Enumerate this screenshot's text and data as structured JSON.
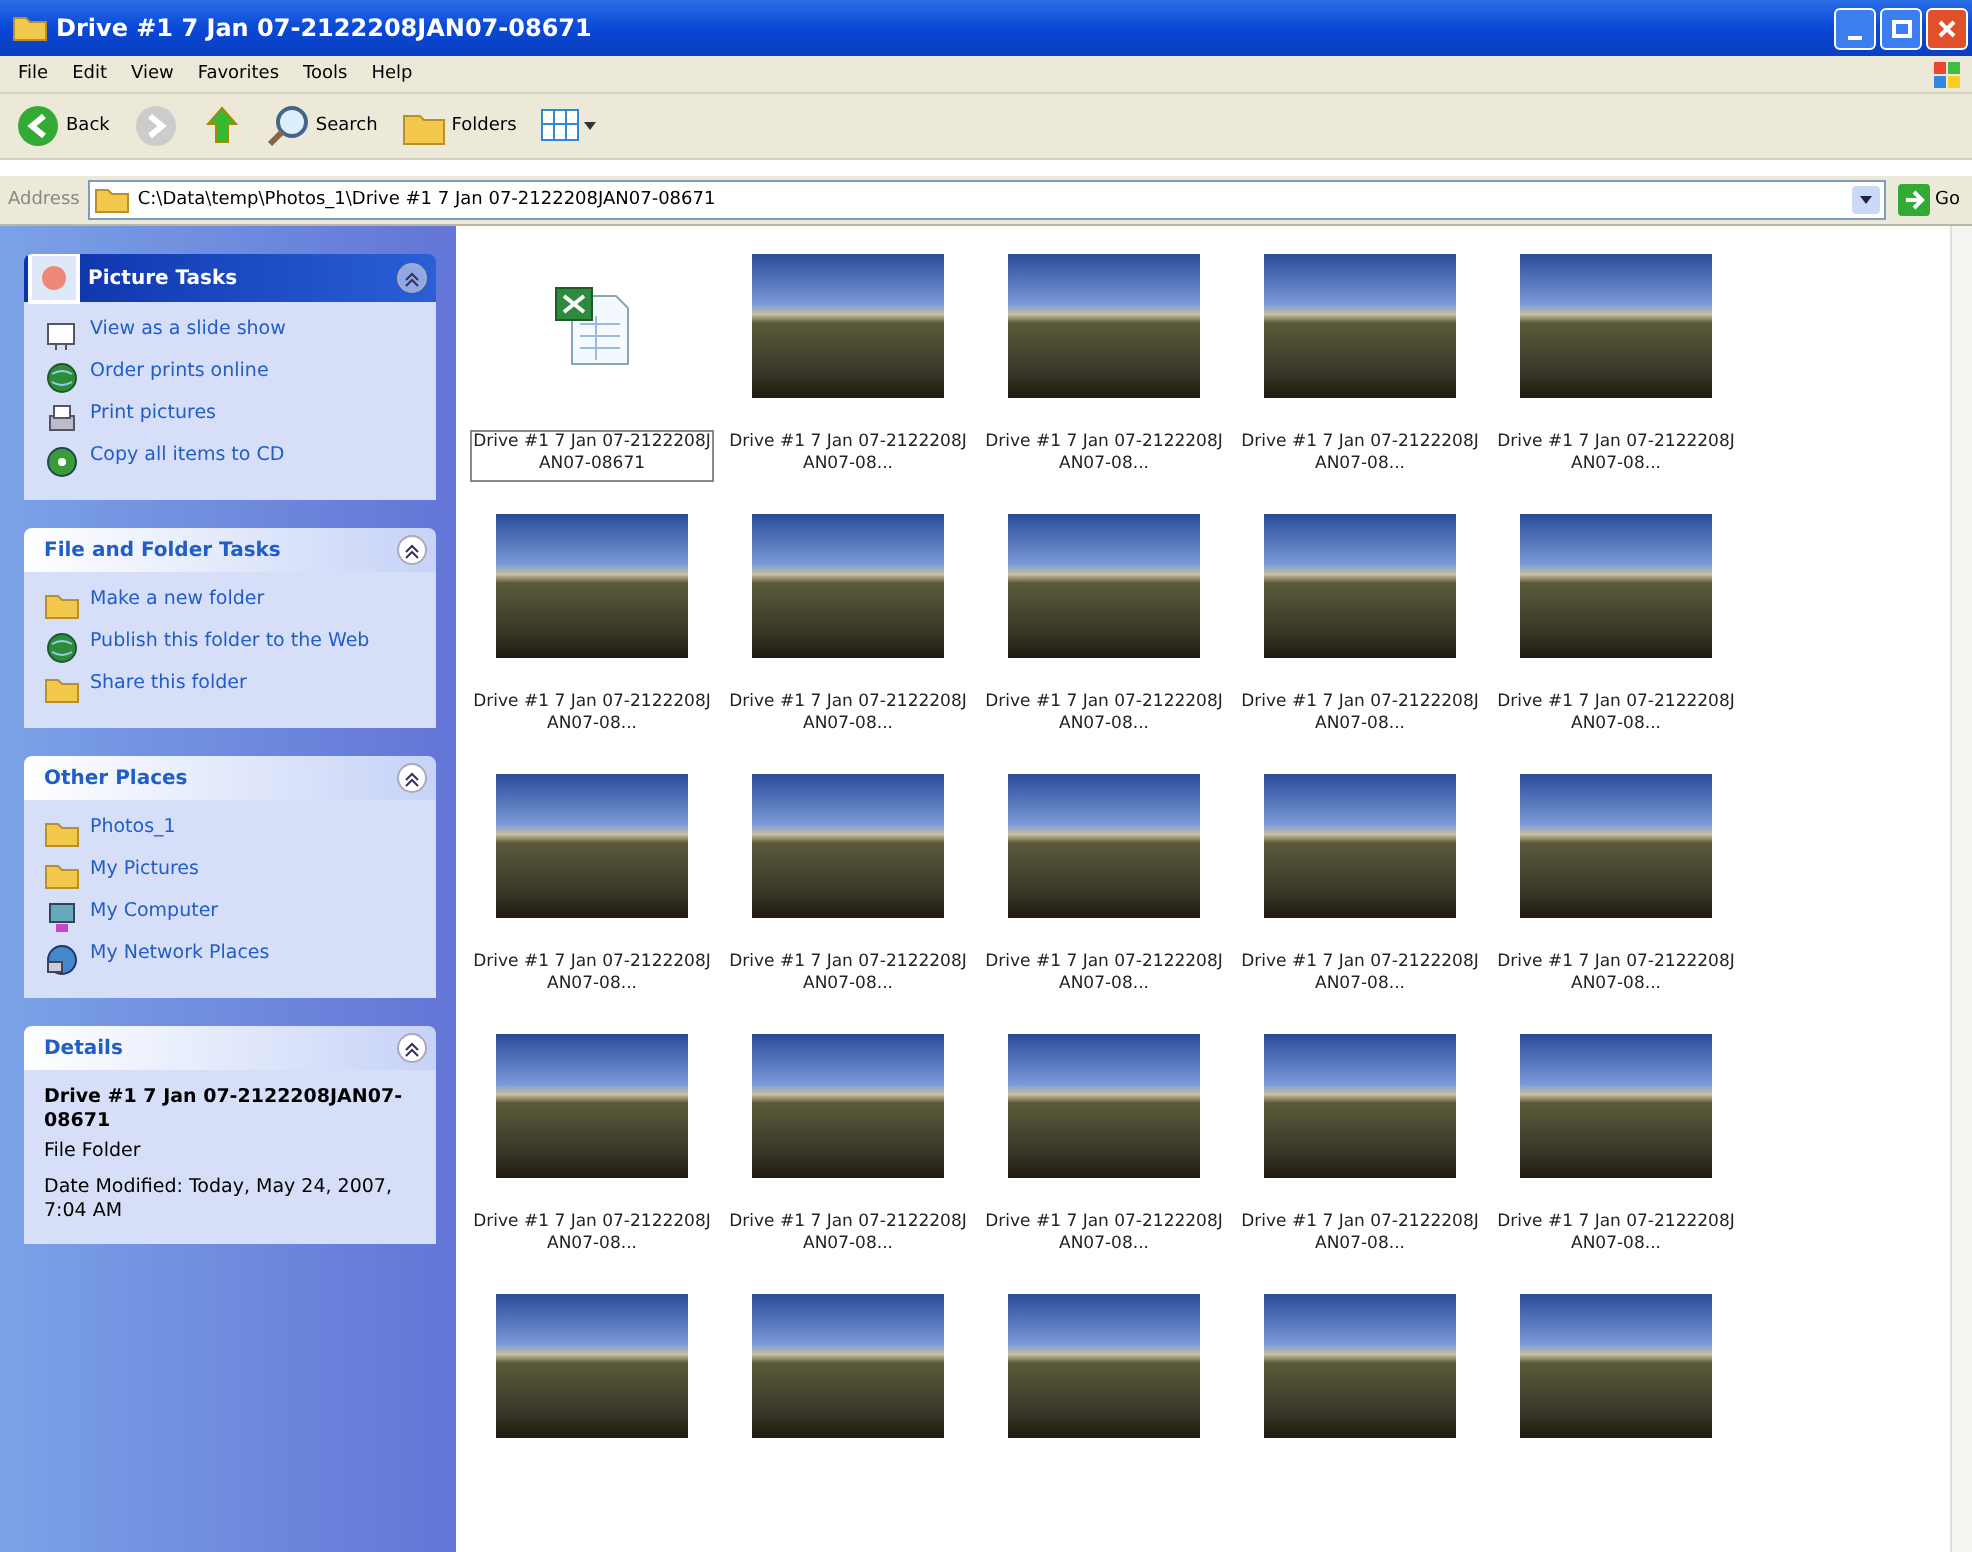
{
  "window": {
    "title": "Drive #1 7 Jan 07-2122208JAN07-08671"
  },
  "menu": [
    "File",
    "Edit",
    "View",
    "Favorites",
    "Tools",
    "Help"
  ],
  "toolbar": [
    {
      "kind": "back",
      "label": "Back"
    },
    {
      "kind": "forward"
    },
    {
      "kind": "up"
    },
    {
      "kind": "search",
      "label": "Search"
    },
    {
      "kind": "folders",
      "label": "Folders"
    },
    {
      "kind": "views"
    }
  ],
  "address": {
    "label": "Address",
    "value": "C:\\Data\\temp\\Photos_1\\Drive #1 7 Jan 07-2122208JAN07-08671",
    "go": "Go"
  },
  "sidebar": [
    {
      "title": "Picture Tasks",
      "kind": "special",
      "items": [
        {
          "kind": "slideshow",
          "label": "View as a slide show"
        },
        {
          "kind": "globe",
          "label": "Order prints online"
        },
        {
          "kind": "printer",
          "label": "Print pictures"
        },
        {
          "kind": "disc",
          "label": "Copy all items to CD"
        }
      ]
    },
    {
      "title": "File and Folder Tasks",
      "kind": "normal",
      "items": [
        {
          "kind": "folder",
          "label": "Make a new folder"
        },
        {
          "kind": "globe",
          "label": "Publish this folder to the Web"
        },
        {
          "kind": "folder",
          "label": "Share this folder"
        }
      ]
    },
    {
      "title": "Other Places",
      "kind": "normal",
      "items": [
        {
          "kind": "folder",
          "label": "Photos_1"
        },
        {
          "kind": "folder",
          "label": "My Pictures"
        },
        {
          "kind": "computer",
          "label": "My Computer"
        },
        {
          "kind": "network",
          "label": "My Network Places"
        }
      ]
    },
    {
      "title": "Details",
      "kind": "details",
      "name": "Drive #1 7 Jan 07-2122208JAN07-08671",
      "type": "File Folder",
      "modified": "Date Modified: Today, May 24, 2007, 7:04 AM"
    }
  ],
  "files": [
    {
      "kind": "spreadsheet",
      "label": "Drive #1 7 Jan 07-2122208JAN07-08671",
      "selected": true
    },
    {
      "kind": "photo",
      "label": "Drive #1 7 Jan 07-2122208JAN07-08...",
      "selected": false
    },
    {
      "kind": "photo",
      "label": "Drive #1 7 Jan 07-2122208JAN07-08...",
      "selected": false
    },
    {
      "kind": "photo",
      "label": "Drive #1 7 Jan 07-2122208JAN07-08...",
      "selected": false
    },
    {
      "kind": "photo",
      "label": "Drive #1 7 Jan 07-2122208JAN07-08...",
      "selected": false
    },
    {
      "kind": "photo",
      "label": "Drive #1 7 Jan 07-2122208JAN07-08...",
      "selected": false
    },
    {
      "kind": "photo",
      "label": "Drive #1 7 Jan 07-2122208JAN07-08...",
      "selected": false
    },
    {
      "kind": "photo",
      "label": "Drive #1 7 Jan 07-2122208JAN07-08...",
      "selected": false
    },
    {
      "kind": "photo",
      "label": "Drive #1 7 Jan 07-2122208JAN07-08...",
      "selected": false
    },
    {
      "kind": "photo",
      "label": "Drive #1 7 Jan 07-2122208JAN07-08...",
      "selected": false
    },
    {
      "kind": "photo",
      "label": "Drive #1 7 Jan 07-2122208JAN07-08...",
      "selected": false
    },
    {
      "kind": "photo",
      "label": "Drive #1 7 Jan 07-2122208JAN07-08...",
      "selected": false
    },
    {
      "kind": "photo",
      "label": "Drive #1 7 Jan 07-2122208JAN07-08...",
      "selected": false
    },
    {
      "kind": "photo",
      "label": "Drive #1 7 Jan 07-2122208JAN07-08...",
      "selected": false
    },
    {
      "kind": "photo",
      "label": "Drive #1 7 Jan 07-2122208JAN07-08...",
      "selected": false
    },
    {
      "kind": "photo",
      "label": "Drive #1 7 Jan 07-2122208JAN07-08...",
      "selected": false
    },
    {
      "kind": "photo",
      "label": "Drive #1 7 Jan 07-2122208JAN07-08...",
      "selected": false
    },
    {
      "kind": "photo",
      "label": "Drive #1 7 Jan 07-2122208JAN07-08...",
      "selected": false
    },
    {
      "kind": "photo",
      "label": "Drive #1 7 Jan 07-2122208JAN07-08...",
      "selected": false
    },
    {
      "kind": "photo",
      "label": "Drive #1 7 Jan 07-2122208JAN07-08...",
      "selected": false
    },
    {
      "kind": "photo"
    },
    {
      "kind": "photo"
    },
    {
      "kind": "photo"
    },
    {
      "kind": "photo"
    },
    {
      "kind": "photo"
    }
  ]
}
